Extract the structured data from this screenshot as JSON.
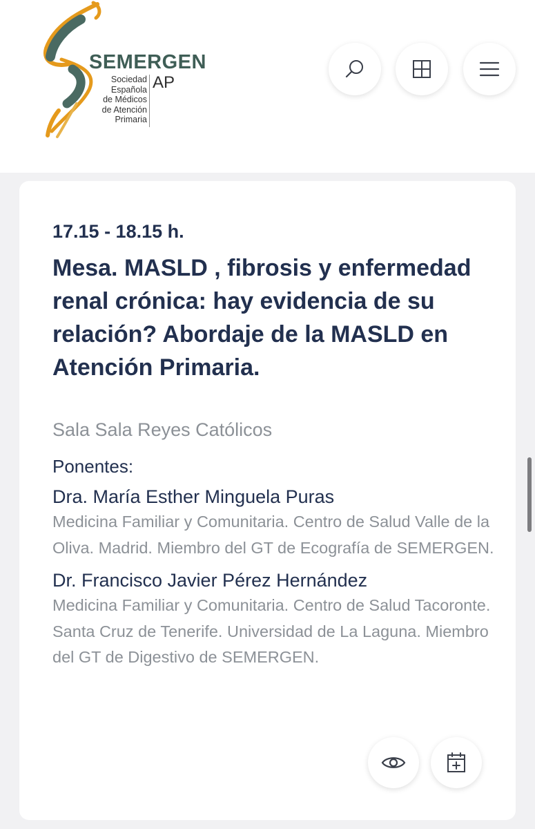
{
  "logo": {
    "name": "SEMERGEN",
    "subtitle_lines": [
      "Sociedad",
      "Española",
      "de Médicos",
      "de Atención",
      "Primaria"
    ],
    "suffix": "AP"
  },
  "header": {
    "buttons": [
      {
        "name": "search-button",
        "icon": "search-icon"
      },
      {
        "name": "grid-button",
        "icon": "grid-icon"
      },
      {
        "name": "menu-button",
        "icon": "hamburger-menu-icon"
      }
    ]
  },
  "session": {
    "time": "17.15 - 18.15 h.",
    "title": "Mesa. MASLD , fibrosis y enfermedad renal crónica: hay evidencia de su relación? Abordaje de la MASLD en Atención Primaria.",
    "room": "Sala Sala Reyes Católicos",
    "speakers_label": "Ponentes:",
    "speakers": [
      {
        "name": "Dra. María Esther Minguela Puras",
        "affiliation": "Medicina Familiar y Comunitaria. Centro de Salud Valle de la Oliva. Madrid. Miembro del GT de Ecografía de SEMERGEN."
      },
      {
        "name": "Dr. Francisco Javier Pérez Hernández",
        "affiliation": "Medicina Familiar y Comunitaria. Centro de Salud Tacoronte. Santa Cruz de Tenerife. Universidad de La Laguna. Miembro del GT de Digestivo de SEMERGEN."
      }
    ],
    "actions": [
      {
        "name": "view-button",
        "icon": "eye-icon"
      },
      {
        "name": "add-to-calendar-button",
        "icon": "calendar-add-icon"
      }
    ]
  },
  "colors": {
    "title": "#22304f",
    "muted": "#8c9197",
    "brand_green": "#3f5e56",
    "brand_orange": "#e59a1c",
    "background": "#f1f1f3"
  }
}
